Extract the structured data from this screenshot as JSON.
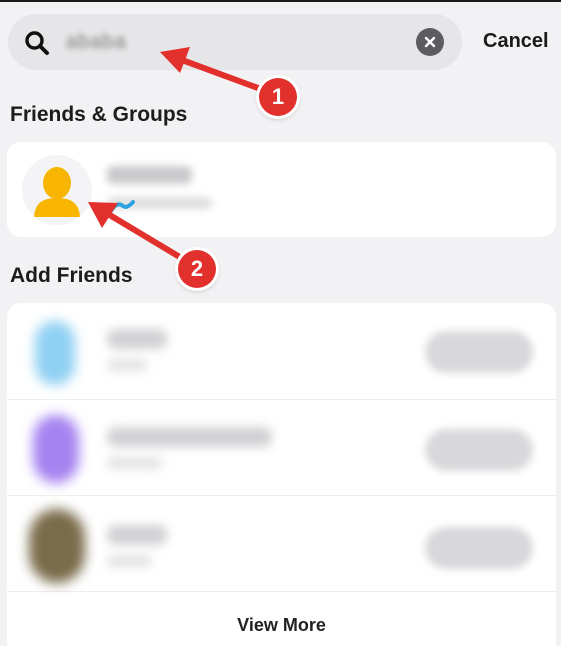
{
  "search": {
    "query_blurred": "ababa",
    "cancel_label": "Cancel"
  },
  "sections": {
    "friends_groups_title": "Friends & Groups",
    "add_friends_title": "Add Friends"
  },
  "add_friends": {
    "view_more_label": "View More"
  },
  "annotations": {
    "step1": "1",
    "step2": "2"
  },
  "colors": {
    "accent_red": "#e2302c",
    "avatar_yellow": "#f7b500",
    "search_bg": "#e6e6e8"
  }
}
